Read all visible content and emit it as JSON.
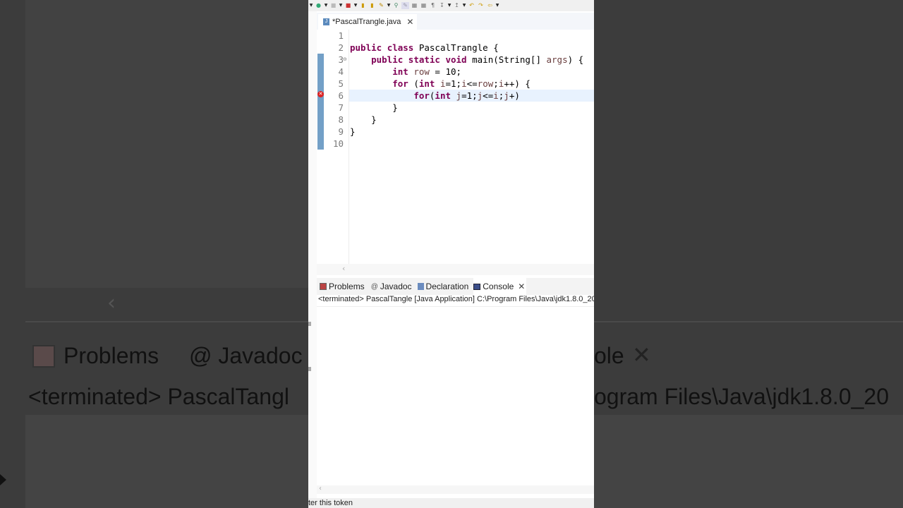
{
  "editor_tab": {
    "title": "*PascalTrangle.java"
  },
  "code": {
    "line_numbers": [
      "1",
      "2",
      "3",
      "4",
      "5",
      "6",
      "7",
      "8",
      "9",
      "10"
    ],
    "lines": [
      "",
      "public class PascalTrangle {",
      "    public static void main(String[] args) {",
      "        int row = 10;",
      "        for (int i=1;i<=row;i++) {",
      "            for(int j=1;j<=i;j+)",
      "        }",
      "    }",
      "}",
      ""
    ],
    "error_line": "6"
  },
  "views": {
    "tabs": [
      "Problems",
      "Javadoc",
      "Declaration",
      "Console"
    ],
    "active_tab": "Console",
    "terminated_line": "<terminated> PascalTangle [Java Application] C:\\Program Files\\Java\\jdk1.8.0_20"
  },
  "status": {
    "text": "ter this token"
  },
  "background": {
    "problems": "Problems",
    "javadoc": "@ Javadoc",
    "console_tail": "ole",
    "terminated_left": "<terminated> PascalTangl",
    "terminated_right": "ogram Files\\Java\\jdk1.8.0_20"
  },
  "icons": {
    "error": "error-icon",
    "close": "close-icon",
    "java_file": "java-file-icon"
  }
}
